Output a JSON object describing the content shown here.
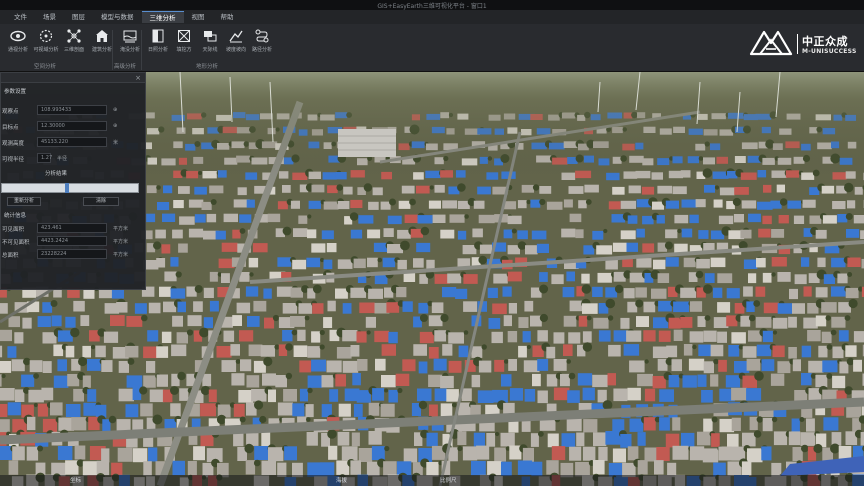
{
  "window": {
    "title": "GIS+EasyEarth三维可视化平台 - 窗口1"
  },
  "menu": {
    "items": [
      {
        "label": "文件"
      },
      {
        "label": "场景"
      },
      {
        "label": "图层"
      },
      {
        "label": "模型与数据"
      },
      {
        "label": "三维分析"
      },
      {
        "label": "视图"
      },
      {
        "label": "帮助"
      }
    ],
    "active_index": 4
  },
  "ribbon": {
    "tools": [
      {
        "icon": "eye-icon",
        "label": "通视分析"
      },
      {
        "icon": "viewshed-icon",
        "label": "可视域分析"
      },
      {
        "icon": "network-icon",
        "label": "三维剖面"
      },
      {
        "icon": "building-icon",
        "label": "建筑分析"
      },
      {
        "icon": "flood-icon",
        "label": "淹没分析"
      },
      {
        "icon": "contour-icon",
        "label": "日照分析"
      },
      {
        "icon": "crop-icon",
        "label": "填挖方"
      },
      {
        "icon": "layers-icon",
        "label": "天际线"
      },
      {
        "icon": "profile-icon",
        "label": "坡度坡向"
      },
      {
        "icon": "route-icon",
        "label": "路径分析"
      }
    ],
    "groups": [
      {
        "label": "空间分析"
      },
      {
        "label": "高级分析"
      },
      {
        "label": "地形分析"
      }
    ]
  },
  "logo": {
    "name_cn": "中正众成",
    "name_en": "M-UNISUCCESS"
  },
  "panel": {
    "section1": "参数设置",
    "rows": [
      {
        "key": "观察点",
        "value": "108.993433",
        "unit": ""
      },
      {
        "key": "目标点",
        "value": "12.30000",
        "unit": ""
      },
      {
        "key": "观测高度",
        "value": "45133.220",
        "unit": "米"
      },
      {
        "key": "可视半径",
        "value": "1.27",
        "unit": "半径"
      }
    ],
    "section2": "分析结果",
    "buttons": [
      {
        "label": "重新分析"
      },
      {
        "label": "清除"
      }
    ],
    "section3": "统计信息",
    "stats": [
      {
        "key": "可见面积",
        "value": "423.461",
        "unit": "平方米"
      },
      {
        "key": "不可见面积",
        "value": "4423.2424",
        "unit": "平方米"
      },
      {
        "key": "总面积",
        "value": "23228224",
        "unit": "平方米"
      }
    ],
    "slider": {
      "fraction": 0.47
    }
  },
  "status": {
    "left": "坐标",
    "mid": "海拔",
    "right": "比例尺"
  },
  "colors": {
    "ground": "#6a6b4f",
    "road": "#8b8d86",
    "roof_blue": "#3a78d2",
    "roof_red": "#c25a52",
    "roof_grey": "#b9b4ad",
    "tree": "#3f4a2c"
  }
}
